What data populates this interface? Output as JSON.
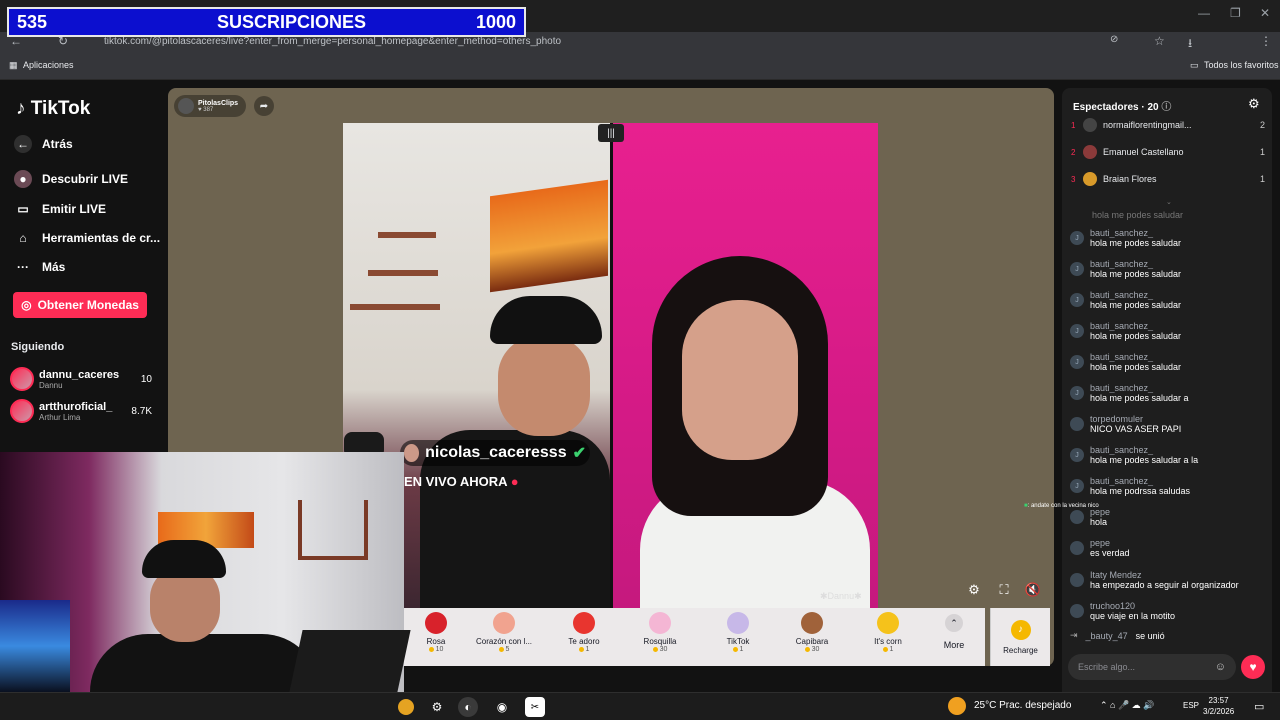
{
  "overlay": {
    "current": "535",
    "label": "SUSCRIPCIONES",
    "goal": "1000"
  },
  "browser": {
    "url": "tiktok.com/@pitolascaceres/live?enter_from_merge=personal_homepage&enter_method=others_photo",
    "bookmarks": {
      "apps": "Aplicaciones",
      "all": "Todos los favoritos"
    }
  },
  "sidebar": {
    "logo": "TikTok",
    "items": [
      {
        "label": "Atrás"
      },
      {
        "label": "Descubrir LIVE"
      },
      {
        "label": "Emitir LIVE"
      },
      {
        "label": "Herramientas de cr..."
      },
      {
        "label": "Más"
      }
    ],
    "coins_button": "Obtener Monedas",
    "following_title": "Siguiendo",
    "following": [
      {
        "name": "dannu_caceres",
        "sub": "Dannu",
        "count": "10"
      },
      {
        "name": "artthuroficial_",
        "sub": "Arthur Lima",
        "count": "8.7K"
      }
    ]
  },
  "stream": {
    "host_name": "PitolasClips",
    "host_likes": "387",
    "guest_tag": "nicolas_caceresss",
    "live_text": "EN VIVO AHORA",
    "partner_tag": "Dannu"
  },
  "gifts": [
    {
      "name": "Rosa",
      "price": "10",
      "color": "#d8222b"
    },
    {
      "name": "Corazón con l...",
      "price": "5",
      "color": "#f1a38f"
    },
    {
      "name": "Te adoro",
      "price": "1",
      "color": "#e8352f"
    },
    {
      "name": "Rosquilla",
      "price": "30",
      "color": "#f4b6d4"
    },
    {
      "name": "TikTok",
      "price": "1",
      "color": "#c7b8e8"
    },
    {
      "name": "Capibara",
      "price": "30",
      "color": "#a0623a"
    },
    {
      "name": "It's corn",
      "price": "1",
      "color": "#f5c21b"
    }
  ],
  "gift_more": "More",
  "recharge": "Recharge",
  "chat": {
    "viewers_title": "Espectadores · 20",
    "viewers": [
      {
        "rank": "1",
        "name": "normaiflorentingmail...",
        "count": "2",
        "color": "#444"
      },
      {
        "rank": "2",
        "name": "Emanuel Castellano",
        "count": "1",
        "color": "#8b3a3a"
      },
      {
        "rank": "3",
        "name": "Braian Flores",
        "count": "1",
        "color": "#d89a2a"
      }
    ],
    "faded": "hola me podes saludar",
    "messages": [
      {
        "user": "bauti_sanchez_",
        "text": "hola me podes saludar",
        "initial": "J"
      },
      {
        "user": "bauti_sanchez_",
        "text": "hola me podes saludar",
        "initial": "J"
      },
      {
        "user": "bauti_sanchez_",
        "text": "hola me podes saludar",
        "initial": "J"
      },
      {
        "user": "bauti_sanchez_",
        "text": "hola me podes saludar",
        "initial": "J"
      },
      {
        "user": "bauti_sanchez_",
        "text": "hola me podes saludar",
        "initial": "J"
      },
      {
        "user": "bauti_sanchez_",
        "text": "hola me podes saludar a",
        "initial": "J"
      },
      {
        "user": "torpedomuler",
        "text": "NICO VAS ASER PAPI",
        "initial": ""
      },
      {
        "user": "bauti_sanchez_",
        "text": "hola me podes saludar a la",
        "initial": "J"
      },
      {
        "user": "bauti_sanchez_",
        "text": "hola me podrssa saludas",
        "initial": "J"
      },
      {
        "user": "pepe",
        "text": "hola",
        "initial": ""
      },
      {
        "user": "pepe",
        "text": "es verdad",
        "initial": ""
      },
      {
        "user": "Itaty Mendez",
        "text": "ha empezado a seguir al organizador",
        "initial": ""
      },
      {
        "user": "truchoo120",
        "text": "que viaje en la motito",
        "initial": ""
      }
    ],
    "joined_user": "_bauty_47",
    "joined_text": "se unió",
    "input_placeholder": "Escribe algo...",
    "overlay_msg": ": andate con la vecina nico"
  },
  "taskbar": {
    "weather": "25°C  Prac. despejado",
    "lang": "ESP",
    "time": "23:57",
    "date": "3/2/2026"
  }
}
